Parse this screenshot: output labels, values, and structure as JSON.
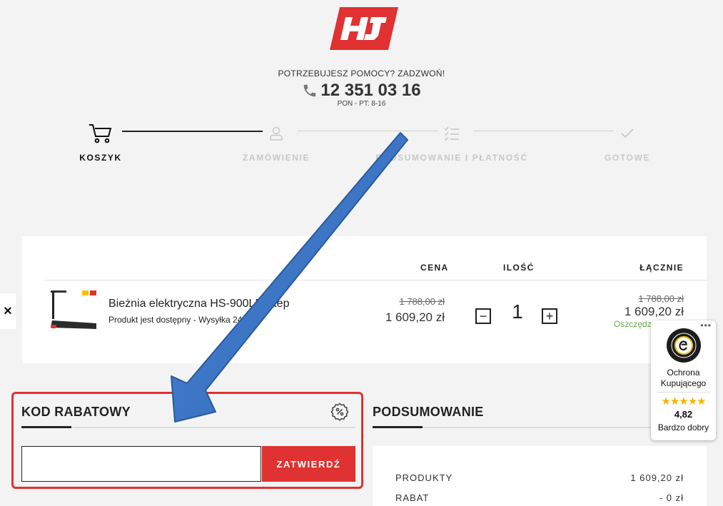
{
  "header": {
    "help_question": "POTRZEBUJESZ POMOCY? ZADZWOŃ!",
    "phone": "12 351 03 16",
    "hours": "PON - PT: 8-16",
    "logo_text": "HJ",
    "brand_color": "#e03232"
  },
  "steps": [
    {
      "label": "KOSZYK",
      "icon": "cart-icon",
      "state": "active"
    },
    {
      "label": "ZAMÓWIENIE",
      "icon": "user-icon",
      "state": "inactive"
    },
    {
      "label": "PODSUMOWANIE I PŁATNOŚĆ",
      "icon": "checklist-icon",
      "state": "inactive"
    },
    {
      "label": "GOTOWE",
      "icon": "check-icon",
      "state": "inactive"
    }
  ],
  "cart": {
    "columns": {
      "price": "CENA",
      "qty": "ILOŚĆ",
      "total": "ŁĄCZNIE"
    },
    "items": [
      {
        "name": "Bieżnia elektryczna HS-900LB Step",
        "availability": "Produkt jest dostępny - Wysyłka 24h",
        "price_old": "1 788,00 zł",
        "price_new": "1 609,20 zł",
        "quantity": "1",
        "total_old": "1 788,00 zł",
        "total_new": "1 609,20 zł",
        "saving": "Oszczędzasz 178,80 zł"
      }
    ],
    "qty_minus": "−",
    "qty_plus": "+",
    "remove": "×"
  },
  "coupon": {
    "title": "KOD RABATOWY",
    "input_value": "",
    "input_placeholder": "",
    "submit_label": "ZATWIERDŹ",
    "highlight_color": "#e03232"
  },
  "summary": {
    "title": "PODSUMOWANIE",
    "rows": [
      {
        "label": "PRODUKTY",
        "value": "1 609,20 zł"
      },
      {
        "label": "RABAT",
        "value": "- 0 zł"
      }
    ]
  },
  "trusted_shops": {
    "menu": "•••",
    "label": "Ochrona Kupującego",
    "stars": "★★★★★",
    "score": "4,82",
    "rating": "Bardzo dobry"
  },
  "annotation": {
    "arrow_color": "#3b74c4"
  }
}
